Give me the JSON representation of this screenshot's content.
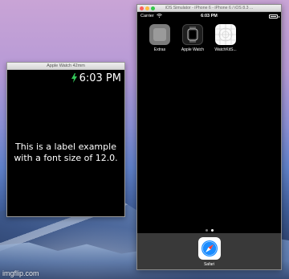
{
  "watch": {
    "title": "Apple Watch 42mm",
    "time": "6:03 PM",
    "label": "This is a label example with a font size of 12.0."
  },
  "simulator": {
    "title": "iOS Simulator - iPhone 6 - iPhone 6 / iOS 8.3 ...",
    "status": {
      "carrier": "Carrier",
      "time": "6:03 PM"
    },
    "apps": [
      {
        "label": "Extras",
        "icon": "folder-icon"
      },
      {
        "label": "Apple Watch",
        "icon": "apple-watch-icon"
      },
      {
        "label": "WatchKitS...",
        "icon": "watchkit-app-icon"
      }
    ],
    "page_dots": {
      "count": 2,
      "active": 2
    },
    "dock": [
      {
        "label": "Safari",
        "icon": "compass-icon"
      }
    ]
  },
  "watermark": "imgflip.com",
  "colors": {
    "charge_bolt": "#34c759",
    "safari_blue": "#1a8cff"
  }
}
